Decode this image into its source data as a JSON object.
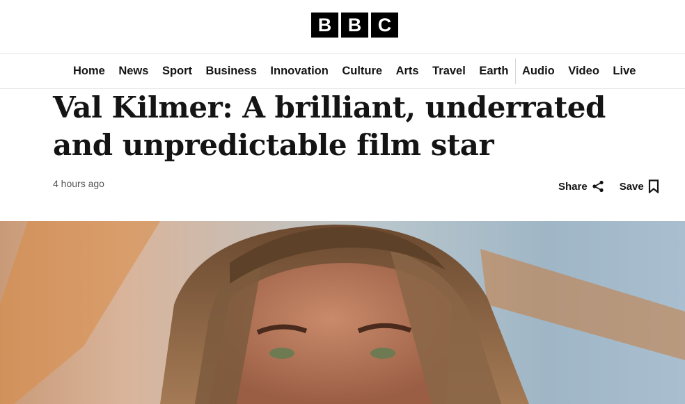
{
  "brand": {
    "letters": [
      "B",
      "B",
      "C"
    ]
  },
  "nav": {
    "items": [
      "Home",
      "News",
      "Sport",
      "Business",
      "Innovation",
      "Culture",
      "Arts",
      "Travel",
      "Earth"
    ],
    "media_items": [
      "Audio",
      "Video",
      "Live"
    ]
  },
  "article": {
    "headline": "Val Kilmer: A brilliant, underrated and unpredictable film star",
    "timestamp": "4 hours ago"
  },
  "actions": {
    "share_label": "Share",
    "save_label": "Save"
  },
  "icons": {
    "share": "share-icon",
    "save": "bookmark-icon"
  },
  "colors": {
    "text": "#141414",
    "muted": "#545658",
    "logo_bg": "#000000"
  }
}
